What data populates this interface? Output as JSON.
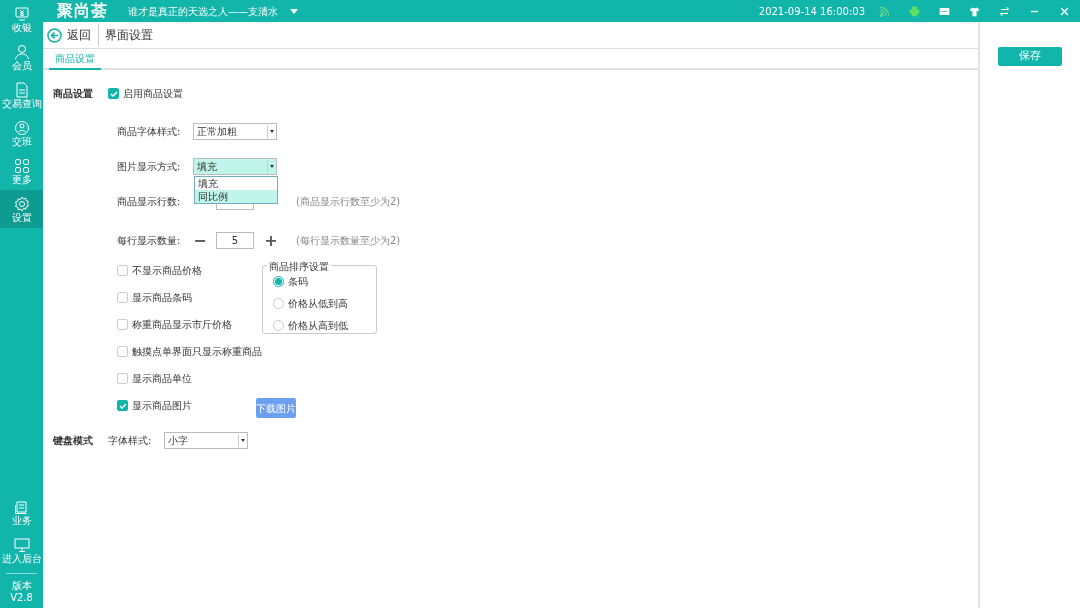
{
  "app": {
    "logo": "聚尚荟",
    "slogan": "谁才是真正的天选之人——支清水",
    "datetime": "2021-09-14 16:00:03"
  },
  "sidebar": {
    "items": [
      {
        "label": "收银",
        "selected": false
      },
      {
        "label": "会员",
        "selected": false
      },
      {
        "label": "交易查询",
        "selected": false
      },
      {
        "label": "交班",
        "selected": false
      },
      {
        "label": "更多",
        "selected": false
      },
      {
        "label": "设置",
        "selected": true
      }
    ],
    "bottom_items": [
      {
        "label": "业务"
      },
      {
        "label": "进入后台"
      }
    ],
    "version_label": "版本",
    "version": "V2.8"
  },
  "header": {
    "back": "返回",
    "title": "界面设置"
  },
  "tabs": [
    {
      "label": "商品设置",
      "selected": true
    }
  ],
  "product_settings": {
    "title": "商品设置",
    "enable": {
      "label": "启用商品设置",
      "checked": true
    },
    "font_style": {
      "label": "商品字体样式:",
      "value": "正常加粗"
    },
    "image_mode": {
      "label": "图片显示方式:",
      "value": "填充",
      "expanded": true,
      "options": [
        {
          "label": "填充",
          "highlighted": false
        },
        {
          "label": "同比例",
          "highlighted": true
        }
      ]
    },
    "rows_count": {
      "label": "商品显示行数:",
      "hint": "(商品显示行数至少为2)"
    },
    "per_row": {
      "label": "每行显示数量:",
      "minus": "−",
      "value": "5",
      "plus": "+",
      "hint": "(每行显示数量至少为2)"
    },
    "options": [
      {
        "label": "不显示商品价格",
        "checked": false
      },
      {
        "label": "显示商品条码",
        "checked": false
      },
      {
        "label": "称重商品显示市斤价格",
        "checked": false
      },
      {
        "label": "触摸点单界面只显示称重商品",
        "checked": false
      },
      {
        "label": "显示商品单位",
        "checked": false
      },
      {
        "label": "显示商品图片",
        "checked": true
      }
    ],
    "download_button": "下载图片",
    "sort": {
      "title": "商品排序设置",
      "options": [
        {
          "label": "条码",
          "selected": true
        },
        {
          "label": "价格从低到高",
          "selected": false
        },
        {
          "label": "价格从高到低",
          "selected": false
        }
      ]
    }
  },
  "keyboard": {
    "title": "键盘模式",
    "font_label": "字体样式:",
    "font_value": "小字"
  },
  "save_button": "保存"
}
